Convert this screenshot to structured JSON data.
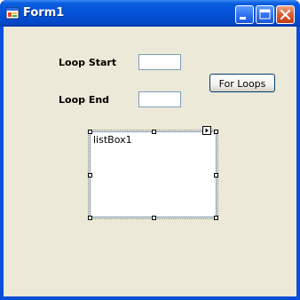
{
  "window": {
    "title": "Form1"
  },
  "form": {
    "loop_start_label": "Loop Start",
    "loop_end_label": "Loop End",
    "loop_start_value": "",
    "loop_end_value": "",
    "for_loops_button": "For Loops",
    "listbox_item": "listBox1"
  },
  "icons": {
    "app": "form-app-icon",
    "minimize": "minimize-icon",
    "maximize": "maximize-icon",
    "close": "close-icon",
    "smart_tag": "smart-tag-arrow-icon"
  },
  "colors": {
    "titlebar": "#0553d8",
    "client_bg": "#ece9d8",
    "close_button": "#dc5a2e"
  }
}
